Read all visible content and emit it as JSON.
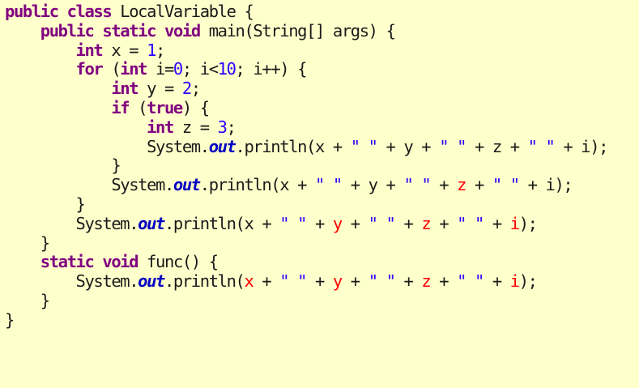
{
  "code": {
    "lines": [
      {
        "indent": 0,
        "tokens": [
          {
            "t": "public",
            "k": "kw"
          },
          {
            "t": " ",
            "k": "txt"
          },
          {
            "t": "class",
            "k": "kw"
          },
          {
            "t": " LocalVariable {",
            "k": "txt"
          }
        ]
      },
      {
        "indent": 1,
        "tokens": [
          {
            "t": "public",
            "k": "kw"
          },
          {
            "t": " ",
            "k": "txt"
          },
          {
            "t": "static",
            "k": "kw"
          },
          {
            "t": " ",
            "k": "txt"
          },
          {
            "t": "void",
            "k": "kw"
          },
          {
            "t": " main(String[] args) {",
            "k": "txt"
          }
        ]
      },
      {
        "indent": 2,
        "tokens": [
          {
            "t": "int",
            "k": "kw"
          },
          {
            "t": " x = ",
            "k": "txt"
          },
          {
            "t": "1",
            "k": "num"
          },
          {
            "t": ";",
            "k": "txt"
          }
        ]
      },
      {
        "indent": 2,
        "tokens": [
          {
            "t": "for",
            "k": "kw"
          },
          {
            "t": " (",
            "k": "txt"
          },
          {
            "t": "int",
            "k": "kw"
          },
          {
            "t": " i=",
            "k": "txt"
          },
          {
            "t": "0",
            "k": "num"
          },
          {
            "t": "; i<",
            "k": "txt"
          },
          {
            "t": "10",
            "k": "num"
          },
          {
            "t": "; i++) {",
            "k": "txt"
          }
        ]
      },
      {
        "indent": 3,
        "tokens": [
          {
            "t": "int",
            "k": "kw"
          },
          {
            "t": " y = ",
            "k": "txt"
          },
          {
            "t": "2",
            "k": "num"
          },
          {
            "t": ";",
            "k": "txt"
          }
        ]
      },
      {
        "indent": 3,
        "tokens": [
          {
            "t": "if",
            "k": "kw"
          },
          {
            "t": " (",
            "k": "txt"
          },
          {
            "t": "true",
            "k": "kw"
          },
          {
            "t": ") {",
            "k": "txt"
          }
        ]
      },
      {
        "indent": 4,
        "tokens": [
          {
            "t": "int",
            "k": "kw"
          },
          {
            "t": " z = ",
            "k": "txt"
          },
          {
            "t": "3",
            "k": "num"
          },
          {
            "t": ";",
            "k": "txt"
          }
        ]
      },
      {
        "indent": 4,
        "tokens": [
          {
            "t": "System.",
            "k": "txt"
          },
          {
            "t": "out",
            "k": "fld"
          },
          {
            "t": ".println(x + ",
            "k": "txt"
          },
          {
            "t": "\" \"",
            "k": "str"
          },
          {
            "t": " + y + ",
            "k": "txt"
          },
          {
            "t": "\" \"",
            "k": "str"
          },
          {
            "t": " + z + ",
            "k": "txt"
          },
          {
            "t": "\" \"",
            "k": "str"
          },
          {
            "t": " + i);",
            "k": "txt"
          }
        ]
      },
      {
        "indent": 3,
        "tokens": [
          {
            "t": "}",
            "k": "txt"
          }
        ]
      },
      {
        "indent": 3,
        "tokens": [
          {
            "t": "System.",
            "k": "txt"
          },
          {
            "t": "out",
            "k": "fld"
          },
          {
            "t": ".println(x + ",
            "k": "txt"
          },
          {
            "t": "\" \"",
            "k": "str"
          },
          {
            "t": " + y + ",
            "k": "txt"
          },
          {
            "t": "\" \"",
            "k": "str"
          },
          {
            "t": " + ",
            "k": "txt"
          },
          {
            "t": "z",
            "k": "err"
          },
          {
            "t": " + ",
            "k": "txt"
          },
          {
            "t": "\" \"",
            "k": "str"
          },
          {
            "t": " + i);",
            "k": "txt"
          }
        ]
      },
      {
        "indent": 2,
        "tokens": [
          {
            "t": "}",
            "k": "txt"
          }
        ]
      },
      {
        "indent": 2,
        "tokens": [
          {
            "t": "System.",
            "k": "txt"
          },
          {
            "t": "out",
            "k": "fld"
          },
          {
            "t": ".println(x + ",
            "k": "txt"
          },
          {
            "t": "\" \"",
            "k": "str"
          },
          {
            "t": " + ",
            "k": "txt"
          },
          {
            "t": "y",
            "k": "err"
          },
          {
            "t": " + ",
            "k": "txt"
          },
          {
            "t": "\" \"",
            "k": "str"
          },
          {
            "t": " + ",
            "k": "txt"
          },
          {
            "t": "z",
            "k": "err"
          },
          {
            "t": " + ",
            "k": "txt"
          },
          {
            "t": "\" \"",
            "k": "str"
          },
          {
            "t": " + ",
            "k": "txt"
          },
          {
            "t": "i",
            "k": "err"
          },
          {
            "t": ");",
            "k": "txt"
          }
        ]
      },
      {
        "indent": 1,
        "tokens": [
          {
            "t": "}",
            "k": "txt"
          }
        ]
      },
      {
        "indent": 1,
        "tokens": [
          {
            "t": "static",
            "k": "kw"
          },
          {
            "t": " ",
            "k": "txt"
          },
          {
            "t": "void",
            "k": "kw"
          },
          {
            "t": " func() {",
            "k": "txt"
          }
        ]
      },
      {
        "indent": 2,
        "tokens": [
          {
            "t": "System.",
            "k": "txt"
          },
          {
            "t": "out",
            "k": "fld"
          },
          {
            "t": ".println(",
            "k": "txt"
          },
          {
            "t": "x",
            "k": "err"
          },
          {
            "t": " + ",
            "k": "txt"
          },
          {
            "t": "\" \"",
            "k": "str"
          },
          {
            "t": " + ",
            "k": "txt"
          },
          {
            "t": "y",
            "k": "err"
          },
          {
            "t": " + ",
            "k": "txt"
          },
          {
            "t": "\" \"",
            "k": "str"
          },
          {
            "t": " + ",
            "k": "txt"
          },
          {
            "t": "z",
            "k": "err"
          },
          {
            "t": " + ",
            "k": "txt"
          },
          {
            "t": "\" \"",
            "k": "str"
          },
          {
            "t": " + ",
            "k": "txt"
          },
          {
            "t": "i",
            "k": "err"
          },
          {
            "t": ");",
            "k": "txt"
          }
        ]
      },
      {
        "indent": 1,
        "tokens": [
          {
            "t": "}",
            "k": "txt"
          }
        ]
      },
      {
        "indent": 0,
        "tokens": [
          {
            "t": "}",
            "k": "txt"
          }
        ]
      }
    ],
    "colors": {
      "background": "#ffffcc",
      "keyword": "#800080",
      "string_literal": "#2a00ff",
      "number_literal": "#2a00ff",
      "static_field": "#0000c0",
      "out_of_scope_variable": "#ff0000",
      "plain_text": "#1a1a1a"
    }
  }
}
